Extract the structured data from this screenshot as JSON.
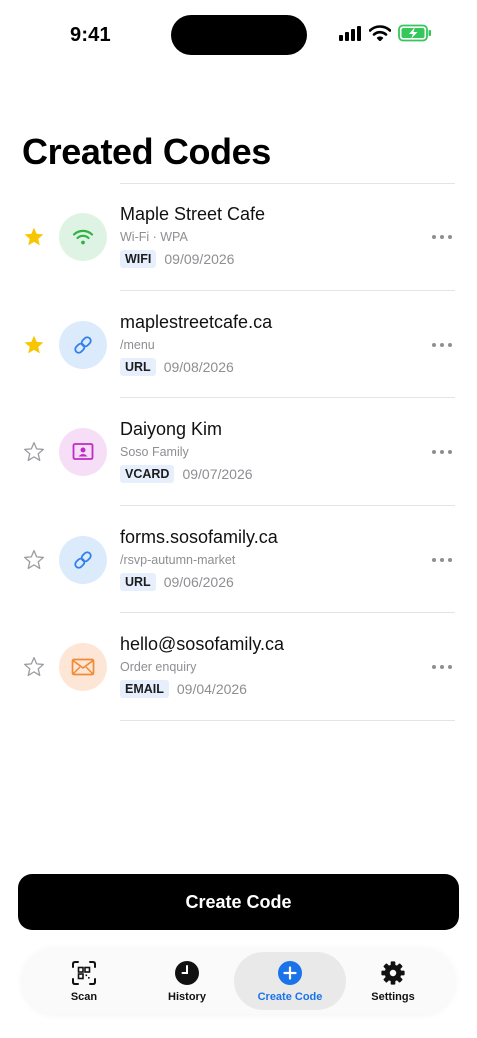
{
  "status_bar": {
    "time": "9:41"
  },
  "page": {
    "title": "Created Codes"
  },
  "codes": [
    {
      "title": "Maple Street Cafe",
      "subtitle": "Wi-Fi · WPA",
      "type": "WIFI",
      "date": "09/09/2026",
      "starred": true,
      "icon": "wifi-icon",
      "icon_color": "#2fb344",
      "icon_bg": "#dff3e5"
    },
    {
      "title": "maplestreetcafe.ca",
      "subtitle": "/menu",
      "type": "URL",
      "date": "09/08/2026",
      "starred": true,
      "icon": "link-icon",
      "icon_color": "#2f80ed",
      "icon_bg": "#dcebfb"
    },
    {
      "title": "Daiyong Kim",
      "subtitle": "Soso Family",
      "type": "VCARD",
      "date": "09/07/2026",
      "starred": false,
      "icon": "contact-card-icon",
      "icon_color": "#c02ac8",
      "icon_bg": "#f6dff6"
    },
    {
      "title": "forms.sosofamily.ca",
      "subtitle": "/rsvp-autumn-market",
      "type": "URL",
      "date": "09/06/2026",
      "starred": false,
      "icon": "link-icon",
      "icon_color": "#2f80ed",
      "icon_bg": "#dcebfb"
    },
    {
      "title": "hello@sosofamily.ca",
      "subtitle": "Order enquiry",
      "type": "EMAIL",
      "date": "09/04/2026",
      "starred": false,
      "icon": "envelope-icon",
      "icon_color": "#f08a34",
      "icon_bg": "#fde6d5"
    }
  ],
  "cta": {
    "label": "Create Code"
  },
  "tabbar": {
    "tabs": [
      {
        "label": "Scan",
        "icon": "qr-scan-icon",
        "active": false
      },
      {
        "label": "History",
        "icon": "clock-icon",
        "active": false
      },
      {
        "label": "Create Code",
        "icon": "plus-circle-icon",
        "active": true
      },
      {
        "label": "Settings",
        "icon": "gear-icon",
        "active": false
      }
    ]
  },
  "colors": {
    "star_filled": "#f7c600",
    "star_outline": "#9a9aa0",
    "accent": "#1a73e8"
  }
}
